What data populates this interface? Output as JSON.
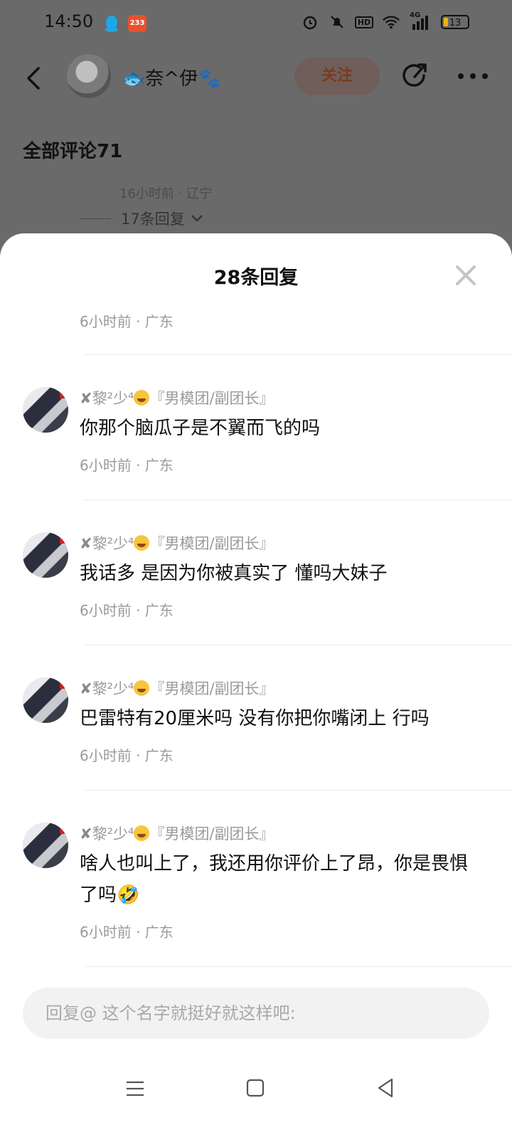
{
  "status_bar": {
    "time": "14:50",
    "app_badge": "233",
    "network": "4G",
    "hd": "HD",
    "battery": "13"
  },
  "header": {
    "author_name": "🐟奈^伊🐾",
    "follow_label": "关注"
  },
  "background": {
    "all_comments": "全部评论71",
    "bg_meta": "16小时前 · 辽宁",
    "bg_replies": "17条回复"
  },
  "sheet": {
    "title": "28条回复",
    "first_meta": "6小时前 · 广东",
    "comments": [
      {
        "name": "黎²少⁴",
        "badge": "『男模团/副团长』",
        "text": "你那个脑瓜子是不翼而飞的吗",
        "meta": "6小时前 · 广东"
      },
      {
        "name": "黎²少⁴",
        "badge": "『男模团/副团长』",
        "text": "我话多 是因为你被真实了 懂吗大妹子",
        "meta": "6小时前 · 广东"
      },
      {
        "name": "黎²少⁴",
        "badge": "『男模团/副团长』",
        "text": "巴雷特有20厘米吗 没有你把你嘴闭上 行吗",
        "meta": "6小时前 · 广东"
      },
      {
        "name": "黎²少⁴",
        "badge": "『男模团/副团长』",
        "text": "啥人也叫上了，我还用你评价上了昂，你是畏惧了吗🤣",
        "meta": "6小时前 · 广东"
      }
    ],
    "reply_placeholder": "回复@ 这个名字就挺好就这样吧:"
  }
}
